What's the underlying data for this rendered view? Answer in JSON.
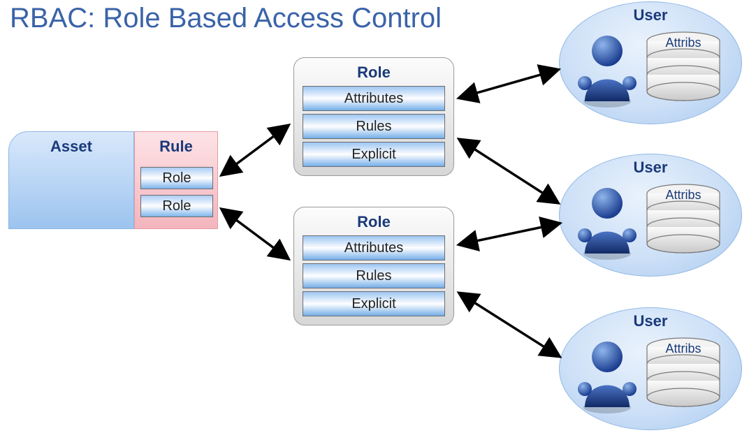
{
  "title": "RBAC: Role Based Access Control",
  "asset": {
    "label": "Asset"
  },
  "rule": {
    "label": "Rule",
    "roles": [
      "Role",
      "Role"
    ]
  },
  "rolePanel": {
    "title": "Role",
    "bands": [
      "Attributes",
      "Rules",
      "Explicit"
    ]
  },
  "user": {
    "label": "User",
    "attribs": "Attribs"
  }
}
